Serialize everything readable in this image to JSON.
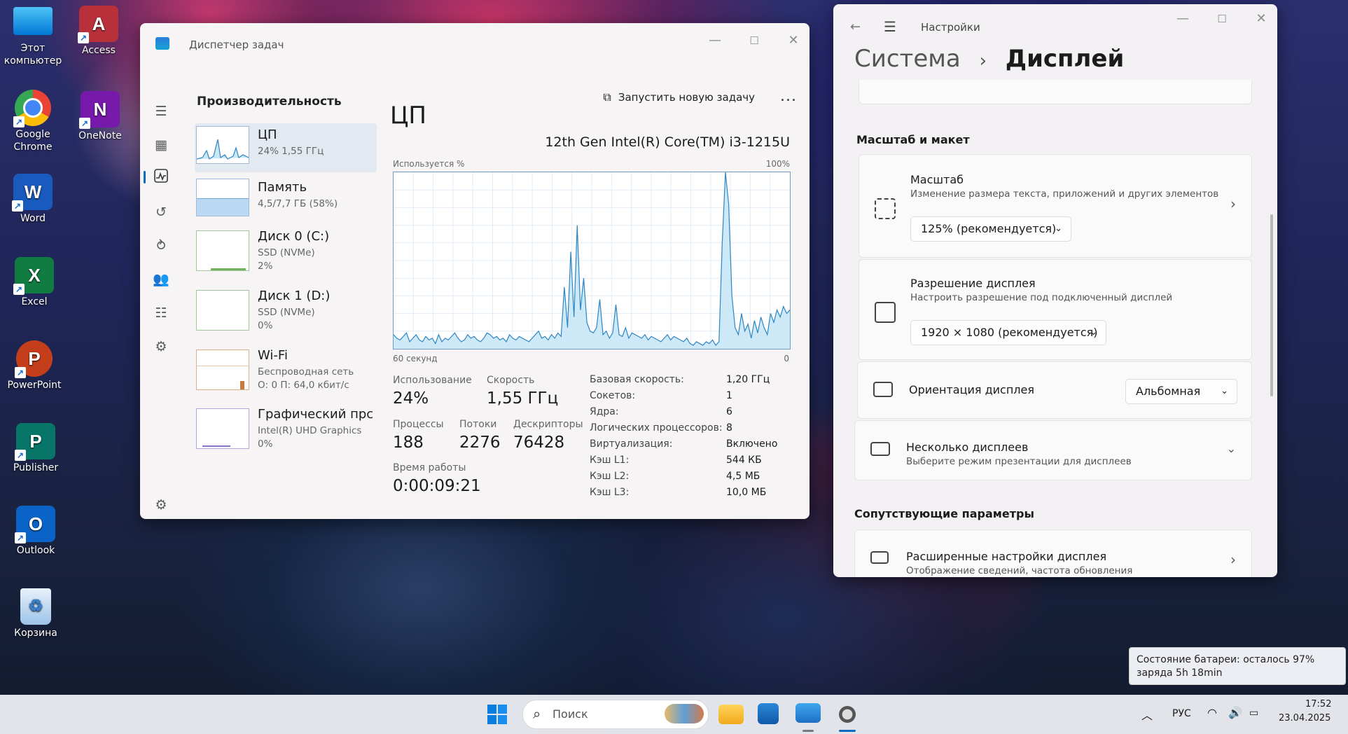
{
  "desktop": {
    "icons": [
      {
        "label": "Этот компьютер"
      },
      {
        "label": "Access"
      },
      {
        "label": "Google Chrome"
      },
      {
        "label": "OneNote"
      },
      {
        "label": "Word"
      },
      {
        "label": "Excel"
      },
      {
        "label": "PowerPoint"
      },
      {
        "label": "Publisher"
      },
      {
        "label": "Outlook"
      },
      {
        "label": "Корзина"
      }
    ]
  },
  "task_manager": {
    "window_title": "Диспетчер задач",
    "page_title": "Производительность",
    "run_task_label": "Запустить новую задачу",
    "more_label": "...",
    "resources": [
      {
        "name": "ЦП",
        "line1": "24% 1,55 ГГц",
        "line2": ""
      },
      {
        "name": "Память",
        "line1": "4,5/7,7 ГБ (58%)",
        "line2": ""
      },
      {
        "name": "Диск 0 (C:)",
        "line1": "SSD (NVMe)",
        "line2": "2%"
      },
      {
        "name": "Диск 1 (D:)",
        "line1": "SSD (NVMe)",
        "line2": "0%"
      },
      {
        "name": "Wi-Fi",
        "line1": "Беспроводная сеть",
        "line2": "О: 0 П: 64,0 кбит/с"
      },
      {
        "name": "Графический прс",
        "line1": "Intel(R) UHD Graphics",
        "line2": "0%"
      }
    ],
    "cpu": {
      "title": "ЦП",
      "model": "12th Gen Intel(R) Core(TM) i3-1215U",
      "graph_label": "Используется %",
      "graph_max": "100%",
      "graph_time": "60 секунд",
      "graph_min": "0",
      "usage_label": "Использование",
      "usage_value": "24%",
      "speed_label": "Скорость",
      "speed_value": "1,55 ГГц",
      "processes_label": "Процессы",
      "processes_value": "188",
      "threads_label": "Потоки",
      "threads_value": "2276",
      "handles_label": "Дескрипторы",
      "handles_value": "76428",
      "uptime_label": "Время работы",
      "uptime_value": "0:00:09:21",
      "details": [
        {
          "k": "Базовая скорость:",
          "v": "1,20 ГГц"
        },
        {
          "k": "Сокетов:",
          "v": "1"
        },
        {
          "k": "Ядра:",
          "v": "6"
        },
        {
          "k": "Логических процессоров:",
          "v": "8"
        },
        {
          "k": "Виртуализация:",
          "v": "Включено"
        },
        {
          "k": "Кэш L1:",
          "v": "544 КБ"
        },
        {
          "k": "Кэш L2:",
          "v": "4,5 МБ"
        },
        {
          "k": "Кэш L3:",
          "v": "10,0 МБ"
        }
      ],
      "usage_history": [
        8,
        6,
        5,
        7,
        9,
        4,
        6,
        8,
        5,
        4,
        7,
        5,
        6,
        3,
        8,
        4,
        6,
        5,
        7,
        9,
        6,
        4,
        5,
        8,
        6,
        7,
        5,
        4,
        6,
        9,
        8,
        6,
        7,
        5,
        6,
        4,
        8,
        6,
        5,
        7,
        6,
        5,
        4,
        6,
        8,
        10,
        6,
        7,
        5,
        8,
        6,
        9,
        7,
        35,
        12,
        55,
        18,
        70,
        22,
        40,
        15,
        10,
        9,
        12,
        28,
        8,
        10,
        6,
        9,
        25,
        8,
        7,
        12,
        6,
        9,
        8,
        7,
        6,
        8,
        5,
        7,
        6,
        5,
        4,
        6,
        8,
        5,
        7,
        6,
        5,
        4,
        6,
        3,
        2,
        4,
        3,
        2,
        4,
        3,
        5,
        2,
        4,
        60,
        100,
        82,
        30,
        12,
        8,
        20,
        10,
        14,
        6,
        16,
        9,
        18,
        12,
        8,
        20,
        15,
        22,
        18,
        24,
        20,
        22
      ]
    }
  },
  "settings": {
    "app_title": "Настройки",
    "breadcrumb_parent": "Система",
    "breadcrumb_sep": "›",
    "breadcrumb_current": "Дисплей",
    "section_scale": "Масштаб и макет",
    "scale_title": "Масштаб",
    "scale_desc": "Изменение размера текста, приложений и других элементов",
    "scale_value": "125% (рекомендуется)",
    "resolution_title": "Разрешение дисплея",
    "resolution_desc": "Настроить разрешение под подключенный дисплей",
    "resolution_value": "1920 × 1080 (рекомендуется)",
    "orientation_title": "Ориентация дисплея",
    "orientation_value": "Альбомная",
    "multi_title": "Несколько дисплеев",
    "multi_desc": "Выберите режим презентации для дисплеев",
    "section_related": "Сопутствующие параметры",
    "advanced_title": "Расширенные настройки дисплея",
    "advanced_desc": "Отображение сведений, частота обновления"
  },
  "taskbar": {
    "search_placeholder": "Поиск",
    "language": "РУС",
    "time": "17:52",
    "date": "23.04.2025",
    "battery_tooltip": "Состояние батареи: осталось 97% заряда 5h 18min"
  }
}
